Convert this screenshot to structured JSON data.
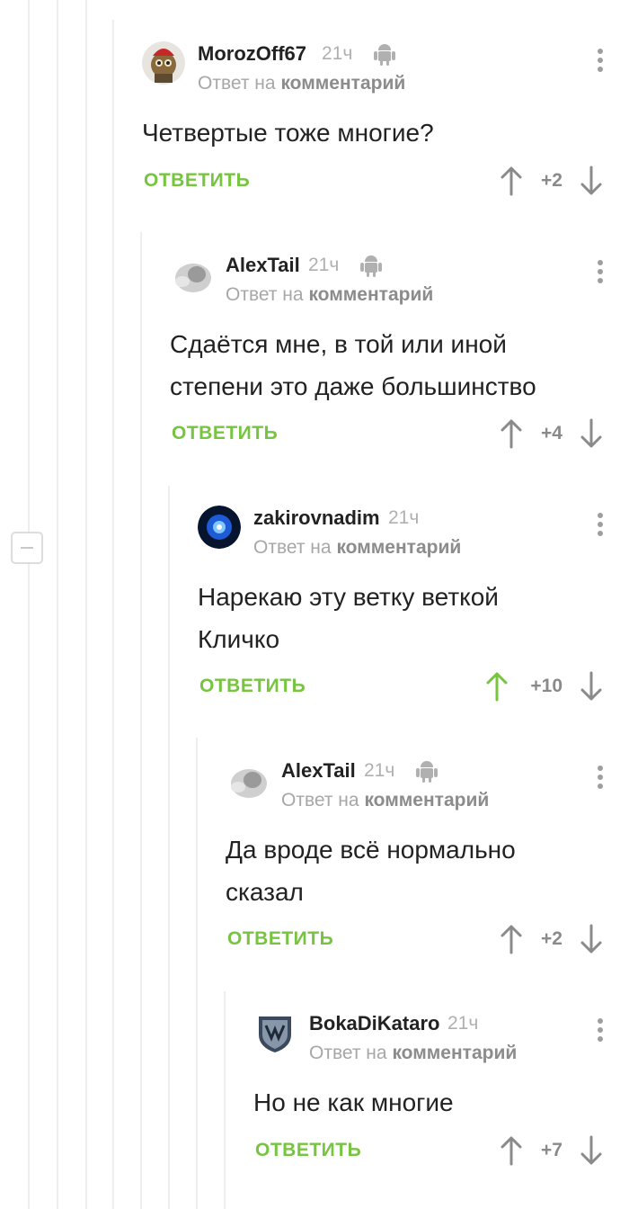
{
  "colors": {
    "accent_green": "#76c43f",
    "muted_text": "#a7a7a7",
    "arrow_gray": "#8a8a8a",
    "thread_line": "#eeeeee"
  },
  "comments": [
    {
      "author": "MorozOff67",
      "time": "21ч",
      "device_icon": "android-icon",
      "reply_prefix": "Ответ на",
      "reply_target": "комментарий",
      "body": "Четвертые тоже многие?",
      "reply_label": "ОТВЕТИТЬ",
      "score": "+2",
      "upvoted": false,
      "avatar": "avatar-icon"
    },
    {
      "author": "AlexTail",
      "time": "21ч",
      "device_icon": "android-icon",
      "reply_prefix": "Ответ на",
      "reply_target": "комментарий",
      "body": "Сдаётся мне, в той или иной степени это даже большинство",
      "reply_label": "ОТВЕТИТЬ",
      "score": "+4",
      "upvoted": false,
      "avatar": "avatar-icon"
    },
    {
      "author": "zakirovnadim",
      "time": "21ч",
      "device_icon": "none",
      "reply_prefix": "Ответ на",
      "reply_target": "комментарий",
      "body": "Нарекаю эту ветку веткой Кличко",
      "reply_label": "ОТВЕТИТЬ",
      "score": "+10",
      "upvoted": true,
      "avatar": "avatar-icon"
    },
    {
      "author": "AlexTail",
      "time": "21ч",
      "device_icon": "android-icon",
      "reply_prefix": "Ответ на",
      "reply_target": "комментарий",
      "body": "Да вроде всё нормально сказал",
      "reply_label": "ОТВЕТИТЬ",
      "score": "+2",
      "upvoted": false,
      "avatar": "avatar-icon"
    },
    {
      "author": "BokaDiKataro",
      "time": "21ч",
      "device_icon": "none",
      "reply_prefix": "Ответ на",
      "reply_target": "комментарий",
      "body": "Но не как многие",
      "reply_label": "ОТВЕТИТЬ",
      "score": "+7",
      "upvoted": false,
      "avatar": "avatar-icon"
    }
  ]
}
